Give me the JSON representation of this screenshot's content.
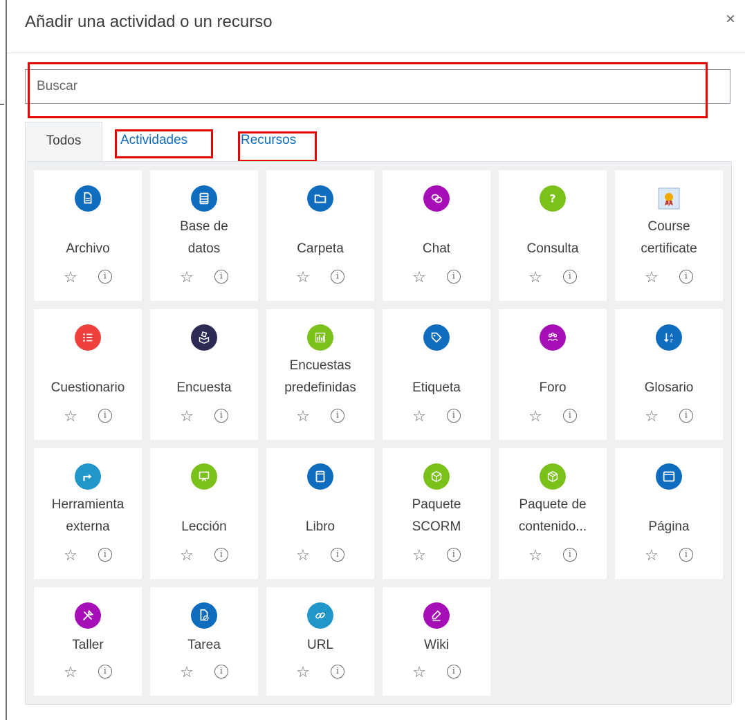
{
  "title": "Añadir una actividad o un recurso",
  "close_label": "×",
  "search": {
    "placeholder": "Buscar"
  },
  "tabs": {
    "all": "Todos",
    "activities": "Actividades",
    "resources": "Recursos"
  },
  "items": [
    {
      "line1": "Archivo",
      "line2": "",
      "icon": "file-icon",
      "color": "#0f6cbf"
    },
    {
      "line1": "Base de",
      "line2": "datos",
      "icon": "database-icon",
      "color": "#0f6cbf"
    },
    {
      "line1": "Carpeta",
      "line2": "",
      "icon": "folder-icon",
      "color": "#0f6cbf"
    },
    {
      "line1": "Chat",
      "line2": "",
      "icon": "chat-icon",
      "color": "#a60eb6"
    },
    {
      "line1": "Consulta",
      "line2": "",
      "icon": "question-icon",
      "color": "#7ac11a"
    },
    {
      "line1": "Course",
      "line2": "certificate",
      "icon": "certificate-icon",
      "color": "#f2a900"
    },
    {
      "line1": "Cuestionario",
      "line2": "",
      "icon": "quiz-icon",
      "color": "#f0403b"
    },
    {
      "line1": "Encuesta",
      "line2": "",
      "icon": "survey-icon",
      "color": "#2d2a55"
    },
    {
      "line1": "Encuestas",
      "line2": "predefinidas",
      "icon": "feedback-icon",
      "color": "#7ac11a"
    },
    {
      "line1": "Etiqueta",
      "line2": "",
      "icon": "label-icon",
      "color": "#0f6cbf"
    },
    {
      "line1": "Foro",
      "line2": "",
      "icon": "forum-icon",
      "color": "#a60eb6"
    },
    {
      "line1": "Glosario",
      "line2": "",
      "icon": "glossary-icon",
      "color": "#0f6cbf"
    },
    {
      "line1": "Herramienta",
      "line2": "externa",
      "icon": "external-tool-icon",
      "color": "#2196c9"
    },
    {
      "line1": "Lección",
      "line2": "",
      "icon": "lesson-icon",
      "color": "#7ac11a"
    },
    {
      "line1": "Libro",
      "line2": "",
      "icon": "book-icon",
      "color": "#0f6cbf"
    },
    {
      "line1": "Paquete",
      "line2": "SCORM",
      "icon": "scorm-icon",
      "color": "#7ac11a"
    },
    {
      "line1": "Paquete de",
      "line2": "contenido...",
      "icon": "content-package-icon",
      "color": "#7ac11a"
    },
    {
      "line1": "Página",
      "line2": "",
      "icon": "page-icon",
      "color": "#0f6cbf"
    },
    {
      "line1": "Taller",
      "line2": "",
      "icon": "workshop-icon",
      "color": "#a60eb6"
    },
    {
      "line1": "Tarea",
      "line2": "",
      "icon": "assignment-icon",
      "color": "#0f6cbf"
    },
    {
      "line1": "URL",
      "line2": "",
      "icon": "url-icon",
      "color": "#2196c9"
    },
    {
      "line1": "Wiki",
      "line2": "",
      "icon": "wiki-icon",
      "color": "#a60eb6"
    }
  ],
  "star_glyph": "☆",
  "info_glyph": "i"
}
